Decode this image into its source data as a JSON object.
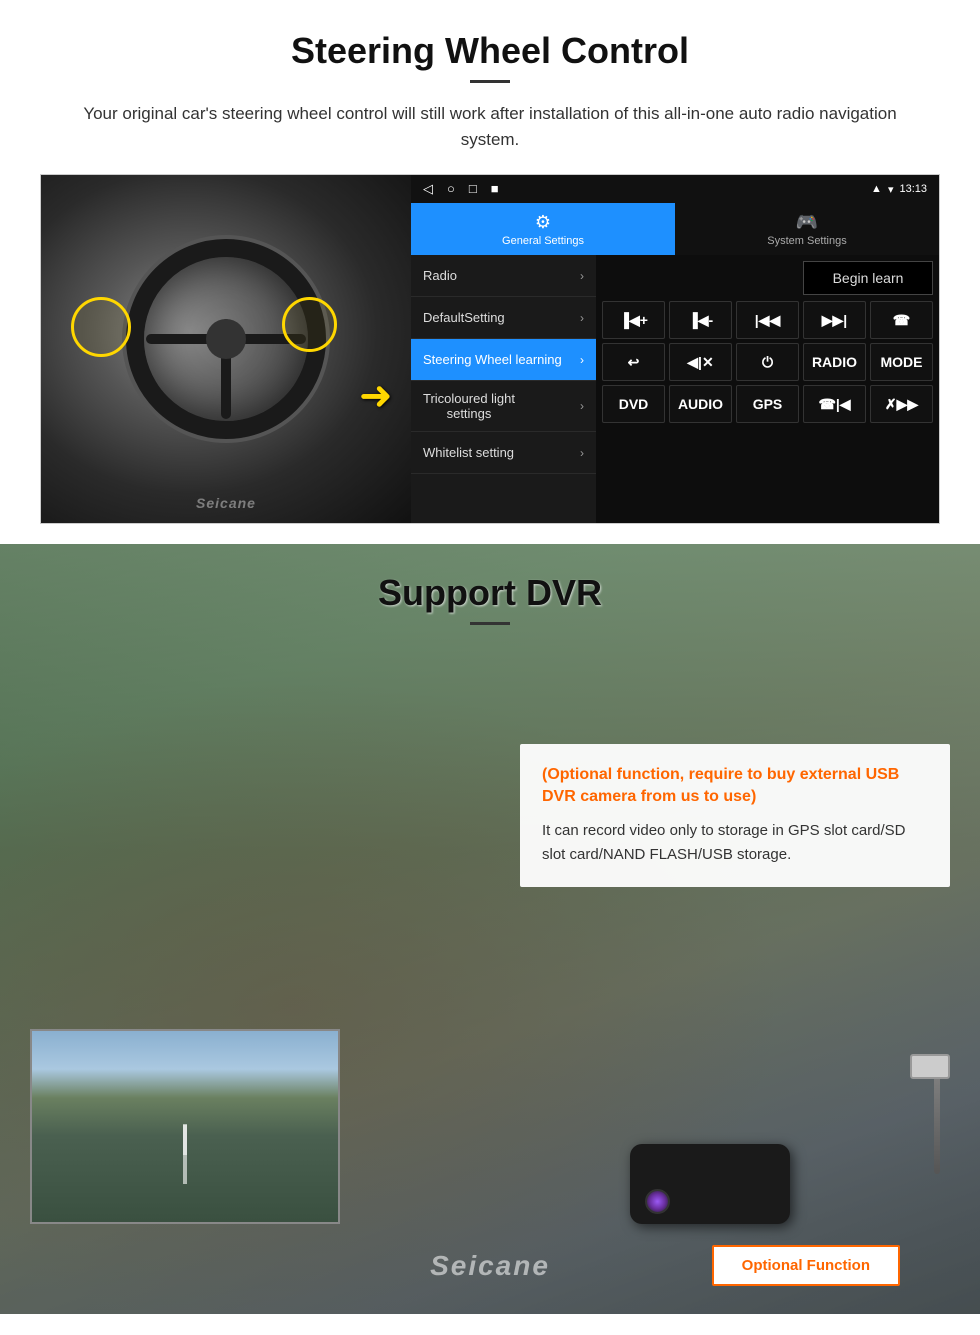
{
  "steering_section": {
    "title": "Steering Wheel Control",
    "description": "Your original car's steering wheel control will still work after installation of this all-in-one auto radio navigation system.",
    "android_ui": {
      "statusbar": {
        "time": "13:13",
        "nav_back": "◁",
        "nav_home": "○",
        "nav_square": "□",
        "nav_menu": "■"
      },
      "tabs": [
        {
          "label": "General Settings",
          "icon": "⚙",
          "active": true
        },
        {
          "label": "System Settings",
          "icon": "🎮",
          "active": false
        }
      ],
      "menu_items": [
        {
          "label": "Radio",
          "active": false
        },
        {
          "label": "DefaultSetting",
          "active": false
        },
        {
          "label": "Steering Wheel learning",
          "active": true
        },
        {
          "label": "Tricoloured light settings",
          "active": false
        },
        {
          "label": "Whitelist setting",
          "active": false
        }
      ],
      "begin_learn_label": "Begin learn",
      "control_buttons_row1": [
        "I◀+",
        "I◀-",
        "I◀◀",
        "▶▶I",
        "☎"
      ],
      "control_buttons_row2": [
        "↩",
        "◀Ix",
        "⏻",
        "RADIO",
        "MODE"
      ],
      "control_buttons_row3": [
        "DVD",
        "AUDIO",
        "GPS",
        "☎I◀",
        "✗▶▶I"
      ]
    }
  },
  "dvr_section": {
    "title": "Support DVR",
    "optional_text": "(Optional function, require to buy external USB DVR camera from us to use)",
    "body_text": "It can record video only to storage in GPS slot card/SD slot card/NAND FLASH/USB storage.",
    "optional_function_label": "Optional Function",
    "seicane_logo": "Seicane"
  }
}
